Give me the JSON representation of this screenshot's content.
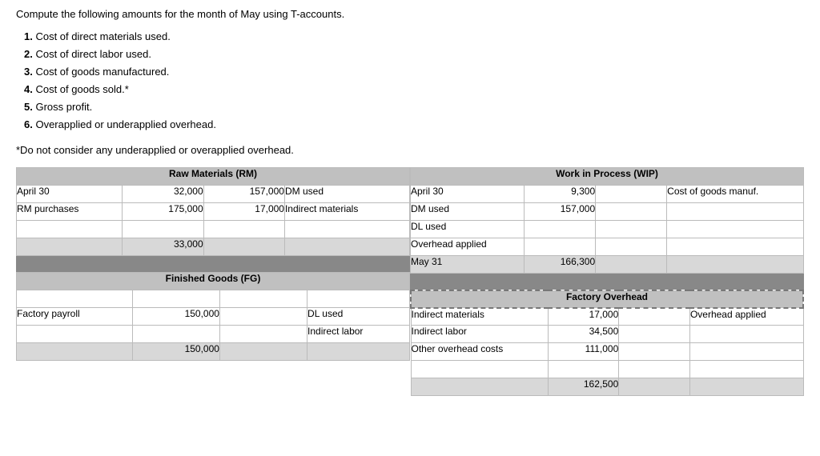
{
  "intro": "Compute the following amounts for the month of May using T-accounts.",
  "items": [
    {
      "num": "1.",
      "text": "Cost of direct materials used."
    },
    {
      "num": "2.",
      "text": "Cost of direct labor used."
    },
    {
      "num": "3.",
      "text": "Cost of goods manufactured."
    },
    {
      "num": "4.",
      "text": "Cost of goods sold.*"
    },
    {
      "num": "5.",
      "text": "Gross profit."
    },
    {
      "num": "6.",
      "text": "Overapplied or underapplied overhead."
    }
  ],
  "footnote": "*Do not consider any underapplied or overapplied overhead.",
  "raw_materials": {
    "header": "Raw Materials (RM)",
    "rows": [
      {
        "left_label": "April 30",
        "left_val": "32,000",
        "right_val": "157,000",
        "right_label": "DM used",
        "shaded": false
      },
      {
        "left_label": "RM purchases",
        "left_val": "175,000",
        "right_val": "17,000",
        "right_label": "Indirect materials",
        "shaded": false
      },
      {
        "left_label": "",
        "left_val": "",
        "right_val": "",
        "right_label": "",
        "shaded": false
      },
      {
        "left_label": "",
        "left_val": "33,000",
        "right_val": "",
        "right_label": "",
        "shaded": false
      }
    ]
  },
  "finished_goods": {
    "header": "Finished Goods (FG)",
    "rows": [
      {
        "left_label": "",
        "left_val": "",
        "right_val": "",
        "right_label": "",
        "shaded": false
      },
      {
        "left_label": "Factory payroll",
        "left_val": "150,000",
        "right_val": "",
        "right_label": "DL used",
        "shaded": false
      },
      {
        "left_label": "",
        "left_val": "",
        "right_val": "",
        "right_label": "Indirect labor",
        "shaded": false
      },
      {
        "left_label": "",
        "left_val": "150,000",
        "right_val": "",
        "right_label": "",
        "shaded": false
      }
    ]
  },
  "wip": {
    "header": "Work in Process (WIP)",
    "rows": [
      {
        "left_label": "April 30",
        "left_val": "9,300",
        "right_val": "",
        "right_label": "Cost of goods manuf.",
        "shaded": false
      },
      {
        "left_label": "DM used",
        "left_val": "157,000",
        "right_val": "",
        "right_label": "",
        "shaded": false
      },
      {
        "left_label": "DL used",
        "left_val": "",
        "right_val": "",
        "right_label": "",
        "shaded": false
      },
      {
        "left_label": "Overhead applied",
        "left_val": "",
        "right_val": "",
        "right_label": "",
        "shaded": false
      },
      {
        "left_label": "May 31",
        "left_val": "166,300",
        "right_val": "",
        "right_label": "",
        "shaded": false
      }
    ]
  },
  "factory_overhead": {
    "header": "Factory Overhead",
    "rows": [
      {
        "left_label": "Indirect materials",
        "left_val": "17,000",
        "right_val": "",
        "right_label": "Overhead applied",
        "shaded": false
      },
      {
        "left_label": "Indirect labor",
        "left_val": "34,500",
        "right_val": "",
        "right_label": "",
        "shaded": false
      },
      {
        "left_label": "Other overhead costs",
        "left_val": "111,000",
        "right_val": "",
        "right_label": "",
        "shaded": false
      },
      {
        "left_label": "",
        "left_val": "",
        "right_val": "",
        "right_label": "",
        "shaded": false
      },
      {
        "left_label": "",
        "left_val": "162,500",
        "right_val": "",
        "right_label": "",
        "shaded": false
      }
    ]
  }
}
